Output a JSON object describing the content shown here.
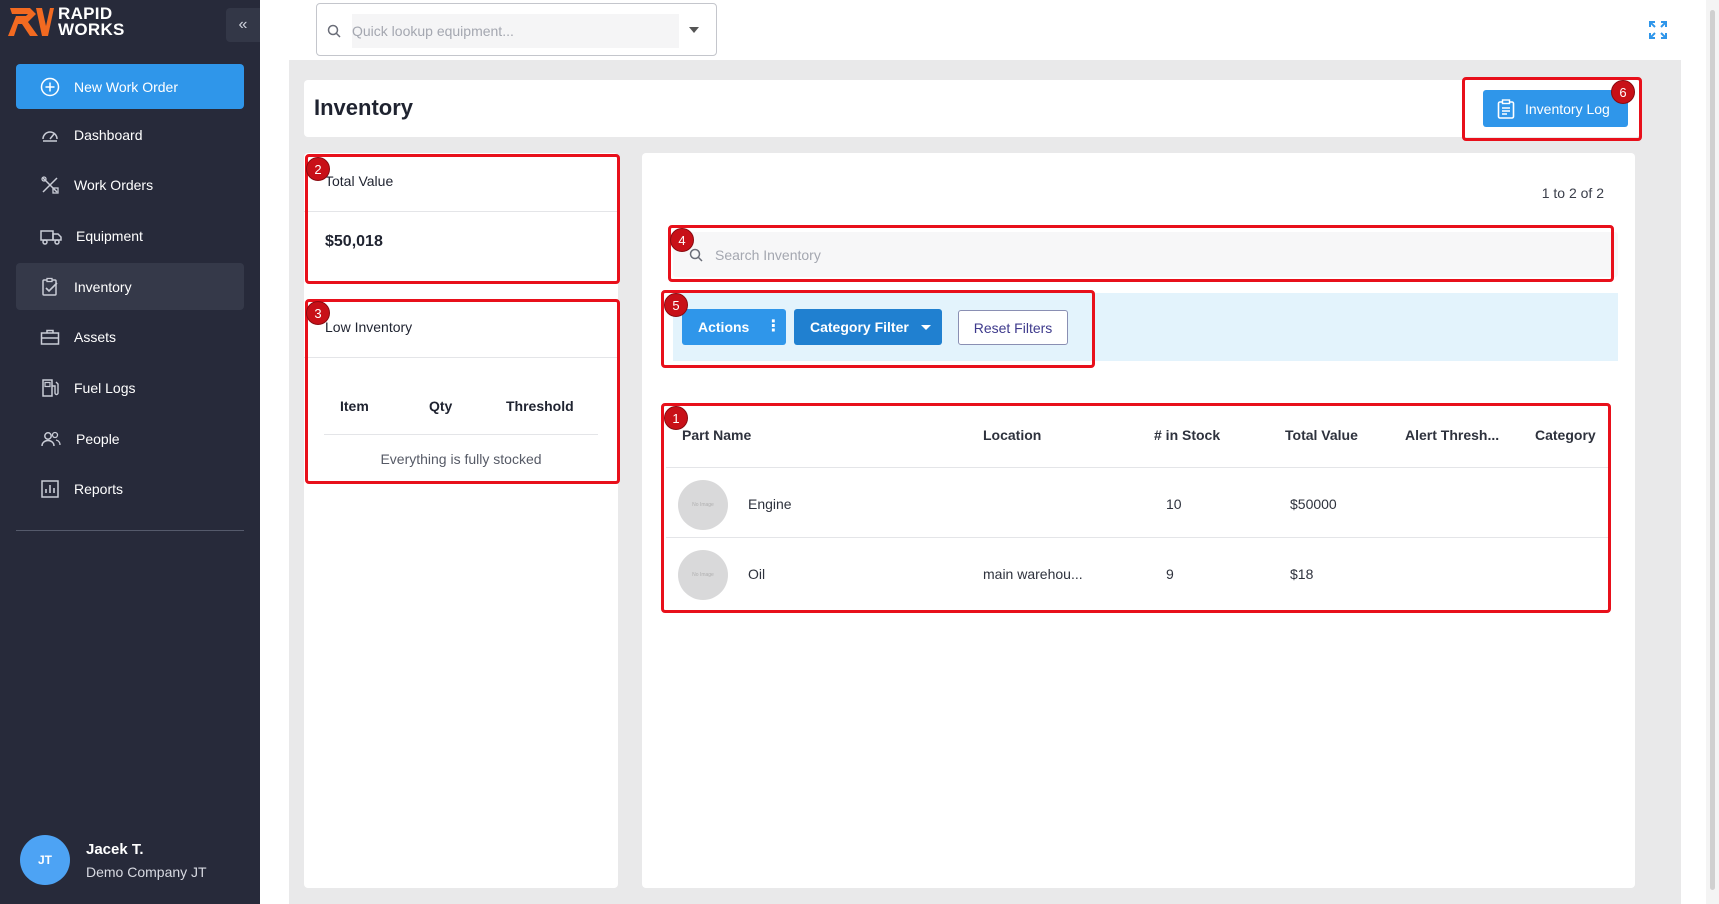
{
  "brand": {
    "line1": "RAPID",
    "line2": "WORKS"
  },
  "sidebar": {
    "collapse_label": "«",
    "new_work_order": "New Work Order",
    "items": [
      {
        "label": "Dashboard",
        "icon": "gauge-icon"
      },
      {
        "label": "Work Orders",
        "icon": "tools-icon"
      },
      {
        "label": "Equipment",
        "icon": "truck-icon"
      },
      {
        "label": "Inventory",
        "icon": "clipboard-check-icon",
        "active": true
      },
      {
        "label": "Assets",
        "icon": "toolbox-icon"
      },
      {
        "label": "Fuel Logs",
        "icon": "fuel-icon"
      },
      {
        "label": "People",
        "icon": "people-icon"
      },
      {
        "label": "Reports",
        "icon": "chart-icon"
      }
    ],
    "user": {
      "initials": "JT",
      "name": "Jacek T.",
      "company": "Demo Company JT"
    }
  },
  "topbar": {
    "lookup_placeholder": "Quick lookup equipment..."
  },
  "page": {
    "title": "Inventory",
    "inventory_log_label": "Inventory Log"
  },
  "total_value": {
    "label": "Total Value",
    "value": "$50,018"
  },
  "low_inventory": {
    "label": "Low Inventory",
    "columns": [
      "Item",
      "Qty",
      "Threshold"
    ],
    "empty_message": "Everything is fully stocked"
  },
  "inventory": {
    "pager": "1 to 2 of 2",
    "search_placeholder": "Search Inventory",
    "actions_label": "Actions",
    "kebab": "⋮",
    "category_filter_label": "Category Filter",
    "reset_filters_label": "Reset Filters",
    "columns": [
      "Part Name",
      "Location",
      "# in Stock",
      "Total Value",
      "Alert Thresh...",
      "Category"
    ],
    "rows": [
      {
        "image_text": "No Image",
        "part_name": "Engine",
        "location": "",
        "stock": "10",
        "total_value": "$50000",
        "alert_threshold": "",
        "category": ""
      },
      {
        "image_text": "No Image",
        "part_name": "Oil",
        "location": "main warehou...",
        "stock": "9",
        "total_value": "$18",
        "alert_threshold": "",
        "category": ""
      }
    ]
  },
  "annotations": [
    "1",
    "2",
    "3",
    "4",
    "5",
    "6"
  ],
  "colors": {
    "sidebar": "#272a3a",
    "accent": "#2f96ea",
    "annotation": "#e8101b"
  }
}
